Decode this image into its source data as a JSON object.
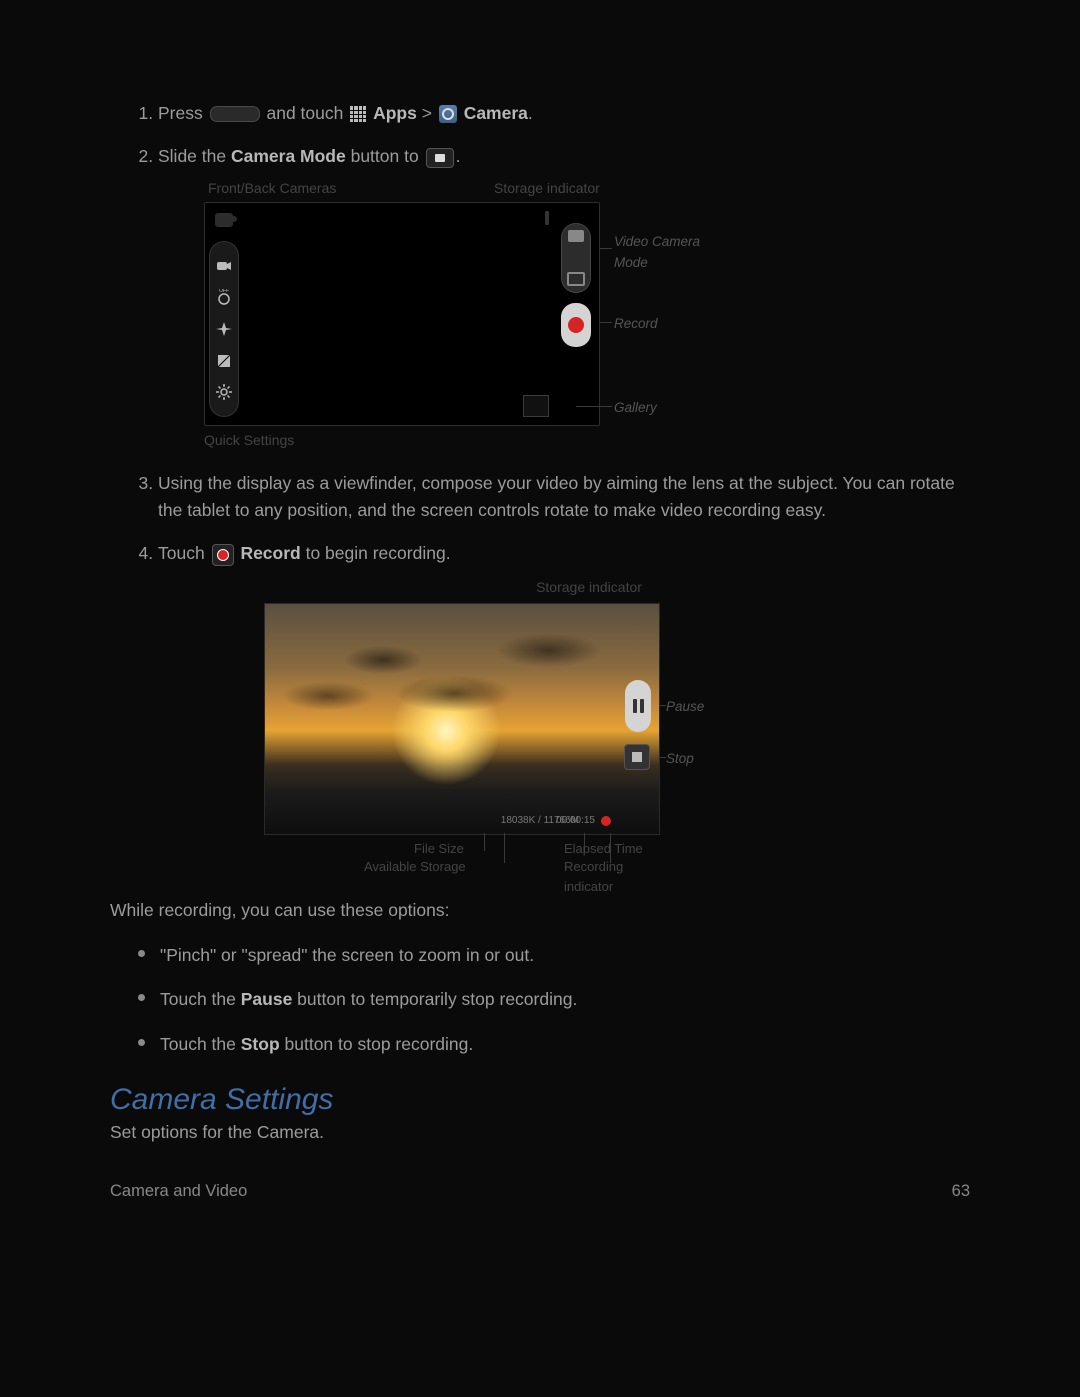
{
  "steps": {
    "s1_press": "Press",
    "s1_andtouch": "and touch",
    "s1_apps": "Apps",
    "s1_gt": " > ",
    "s1_camera": "Camera",
    "s1_period": ".",
    "s2_a": "Slide the ",
    "s2_b": "Camera Mode",
    "s2_c": " button to ",
    "s2_period": ".",
    "s3": "Using the display as a viewfinder, compose your video by aiming the lens at the subject. You can rotate the tablet to any position, and the screen controls rotate to make video recording easy.",
    "s4_a": "Touch ",
    "s4_b": "Record",
    "s4_c": " to begin recording."
  },
  "fig1_labels": {
    "front_back": "Front/Back Cameras",
    "storage": "Storage indicator",
    "video_mode": "Video Camera Mode",
    "record": "Record",
    "gallery": "Gallery",
    "quick": "Quick Settings"
  },
  "fig2_labels": {
    "storage": "Storage indicator",
    "pause": "Pause",
    "stop": "Stop",
    "file_size": "File Size",
    "avail": "Available Storage",
    "elapsed": "Elapsed Time",
    "rec_ind": "Recording indicator"
  },
  "fig2_values": {
    "file_avail": "18038K / 11766M",
    "elapsed_time": "00:00:15"
  },
  "while_recording": "While recording, you can use these options:",
  "opts": {
    "o1": "\"Pinch\" or \"spread\" the screen to zoom in or out.",
    "o2_a": "Touch the ",
    "o2_b": "Pause",
    "o2_c": " button to temporarily stop recording.",
    "o3_a": "Touch the ",
    "o3_b": "Stop",
    "o3_c": " button to stop recording."
  },
  "section_heading": "Camera Settings",
  "section_intro": "Set options for the Camera.",
  "footer_left": "Camera and Video",
  "footer_right": "63"
}
